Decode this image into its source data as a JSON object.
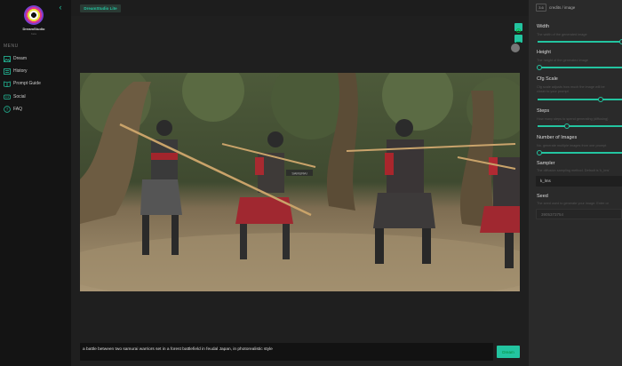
{
  "brand": {
    "name": "DreamStudio",
    "sub": "beta"
  },
  "sidebar": {
    "menu_label": "MENU",
    "items": [
      {
        "label": "Dream",
        "icon": "image-icon"
      },
      {
        "label": "History",
        "icon": "history-icon"
      },
      {
        "label": "Prompt Guide",
        "icon": "book-icon"
      },
      {
        "label": "Social",
        "icon": "social-icon"
      },
      {
        "label": "FAQ",
        "icon": "help-icon"
      }
    ]
  },
  "topbar": {
    "app_badge": "DreamStudio Lite"
  },
  "canvas": {
    "prompt": "a battle between two samurai warriors set in a forest battlefield in feudal Japan, in photorealistic style",
    "dream_button": "Dream",
    "image_caption": "SAMURAI"
  },
  "panel": {
    "credits_value": "3.6",
    "credits_label": "credits / image",
    "width": {
      "title": "Width",
      "help": "The width of the generated image",
      "value": 1.0
    },
    "height": {
      "title": "Height",
      "help": "The height of the generated image",
      "value": 0.0
    },
    "cfg": {
      "title": "Cfg Scale",
      "help": "Cfg scale adjusts how much the image will be",
      "help2": "closer to your prompt",
      "value": 0.74
    },
    "steps": {
      "title": "Steps",
      "help": "How many steps to spend generating (diffusing)",
      "value": 0.33
    },
    "num_images": {
      "title": "Number of Images",
      "help": "No. generate multiple images from one prompt",
      "value": 0.0
    },
    "sampler": {
      "title": "Sampler",
      "help": "The diffusion sampling method. Default is 'k_lms'",
      "value": "k_lms"
    },
    "seed": {
      "title": "Seed",
      "help": "The seed used to generate your image. Enter or",
      "value": "3905373754"
    }
  },
  "colors": {
    "accent": "#23c4a0",
    "sidebar": "#141414",
    "panel": "#2a2a2a"
  }
}
